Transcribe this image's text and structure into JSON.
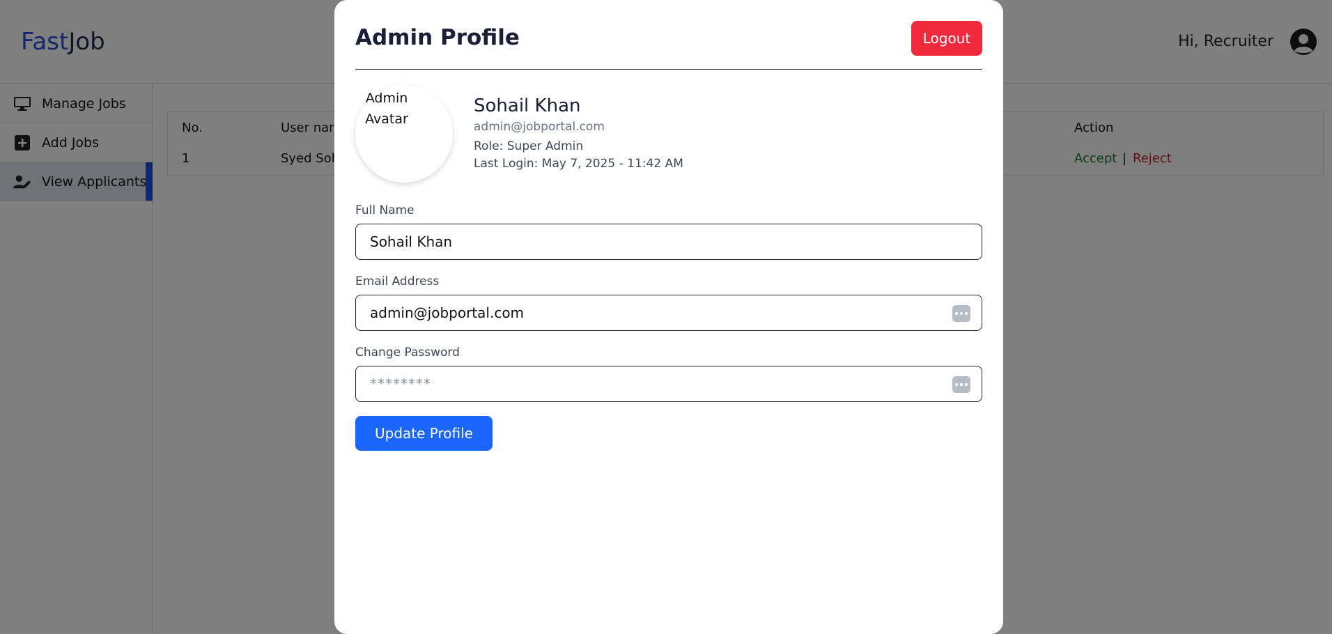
{
  "header": {
    "logo_part1": "Fast",
    "logo_part2": "Job",
    "greeting": "Hi, Recruiter",
    "avatar_icon": "user-circle-icon"
  },
  "sidebar": {
    "items": [
      {
        "label": "Manage Jobs",
        "icon": "monitor-icon",
        "active": false
      },
      {
        "label": "Add Jobs",
        "icon": "plus-square-icon",
        "active": false
      },
      {
        "label": "View Applicants",
        "icon": "user-edit-icon",
        "active": true
      }
    ]
  },
  "table": {
    "headers": [
      "No.",
      "User nam",
      "Action"
    ],
    "rows": [
      {
        "no": "1",
        "user": "Syed Soh",
        "accept": "Accept",
        "separator": "|",
        "reject": "Reject"
      }
    ]
  },
  "modal": {
    "title": "Admin Profile",
    "logout_label": "Logout",
    "avatar_alt": "Admin Avatar",
    "profile": {
      "name": "Sohail Khan",
      "email": "admin@jobportal.com",
      "role": "Role: Super Admin",
      "last_login": "Last Login: May 7, 2025 - 11:42 AM"
    },
    "form": {
      "full_name_label": "Full Name",
      "full_name_value": "Sohail Khan",
      "email_label": "Email Address",
      "email_value": "admin@jobportal.com",
      "password_label": "Change Password",
      "password_placeholder": "********",
      "update_label": "Update Profile"
    }
  },
  "colors": {
    "brand_blue": "#2b4fd6",
    "logout_red": "#f02a3c",
    "primary_button": "#1a66ff",
    "accept_green": "#1e7a34",
    "reject_red": "#c0202a",
    "active_sidebar_bar": "#1f4fd6"
  }
}
